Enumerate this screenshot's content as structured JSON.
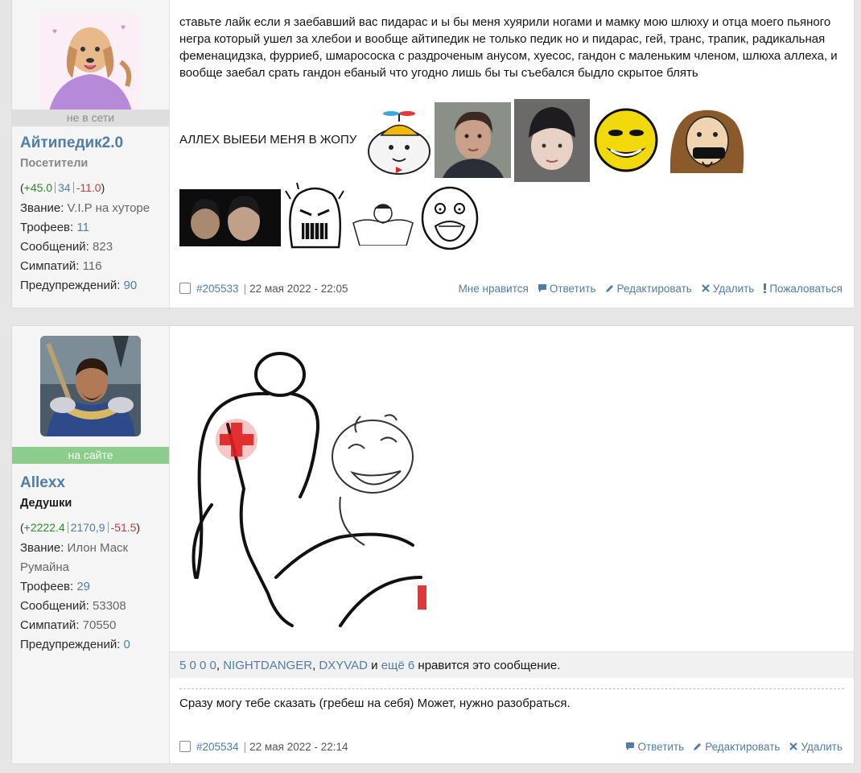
{
  "posts": [
    {
      "user": {
        "status": "не в сети",
        "name": "Айтипедик2.0",
        "group": "Посетители",
        "rep": {
          "open": "(",
          "pos": "+45.0",
          "neu": "34",
          "neg": "-11.0",
          "close": ")"
        },
        "rank_label": "Звание:",
        "rank_value": "V.I.P на хуторе",
        "trophies_label": "Трофеев:",
        "trophies": "11",
        "messages_label": "Сообщений:",
        "messages": "823",
        "likes_label": "Симпатий:",
        "likes": "116",
        "warnings_label": "Предупреждений:",
        "warnings": "90"
      },
      "message": "ставьте лайк если я заебавший вас пидарас и ы бы меня хуярили ногами и мамку мою шлюху и отца моего пьяного негра который ушел за хлебои и вообще айтипедик не только педик но и пидарас, гей, транс, трапик, радикальная феменацидзка, фурриеб, шмарососка с раздроченым анусом, хуесос, гандон с маленьким членом, шлюха аллеха, и вообще заебал срать гандон ебаный что угодно лишь бы ты съебался быдло скрытое блять",
      "caption": "АЛЛЕХ ВЫЕБИ МЕНЯ В ЖОПУ",
      "post_id": "#205533",
      "date": "22 мая 2022 - 22:05",
      "actions": {
        "like": "Мне нравится",
        "reply": "Ответить",
        "edit": "Редактировать",
        "delete": "Удалить",
        "report": "Пожаловаться"
      }
    },
    {
      "user": {
        "status": "на сайте",
        "name": "Allexx",
        "group": "Дедушки",
        "rep": {
          "open": "(",
          "pos": "+2222.4",
          "neu": "2170,9",
          "neg": "-51.5",
          "close": ")"
        },
        "rank_label": "Звание:",
        "rank_value": "Илон Маск Румайна",
        "trophies_label": "Трофеев:",
        "trophies": "29",
        "messages_label": "Сообщений:",
        "messages": "53308",
        "likes_label": "Симпатий:",
        "likes": "70550",
        "warnings_label": "Предупреждений:",
        "warnings": "0"
      },
      "likes_line": {
        "u1": "5 0 0 0",
        "sep1": ", ",
        "u2": "NIGHTDANGER",
        "sep2": ", ",
        "u3": "DXYVAD",
        "and": " и ",
        "more": "ещё 6",
        "tail": " нравится это сообщение."
      },
      "message": "Сразу могу тебе сказать (гребеш на себя) Может, нужно разобраться.",
      "post_id": "#205534",
      "date": "22 мая 2022 - 22:14",
      "actions": {
        "reply": "Ответить",
        "edit": "Редактировать",
        "delete": "Удалить"
      }
    }
  ],
  "colors": {
    "link": "#4f7da6",
    "positive": "#2b8a2b",
    "negative": "#c04040",
    "online": "#8ccc8c",
    "offline": "#dedede"
  }
}
